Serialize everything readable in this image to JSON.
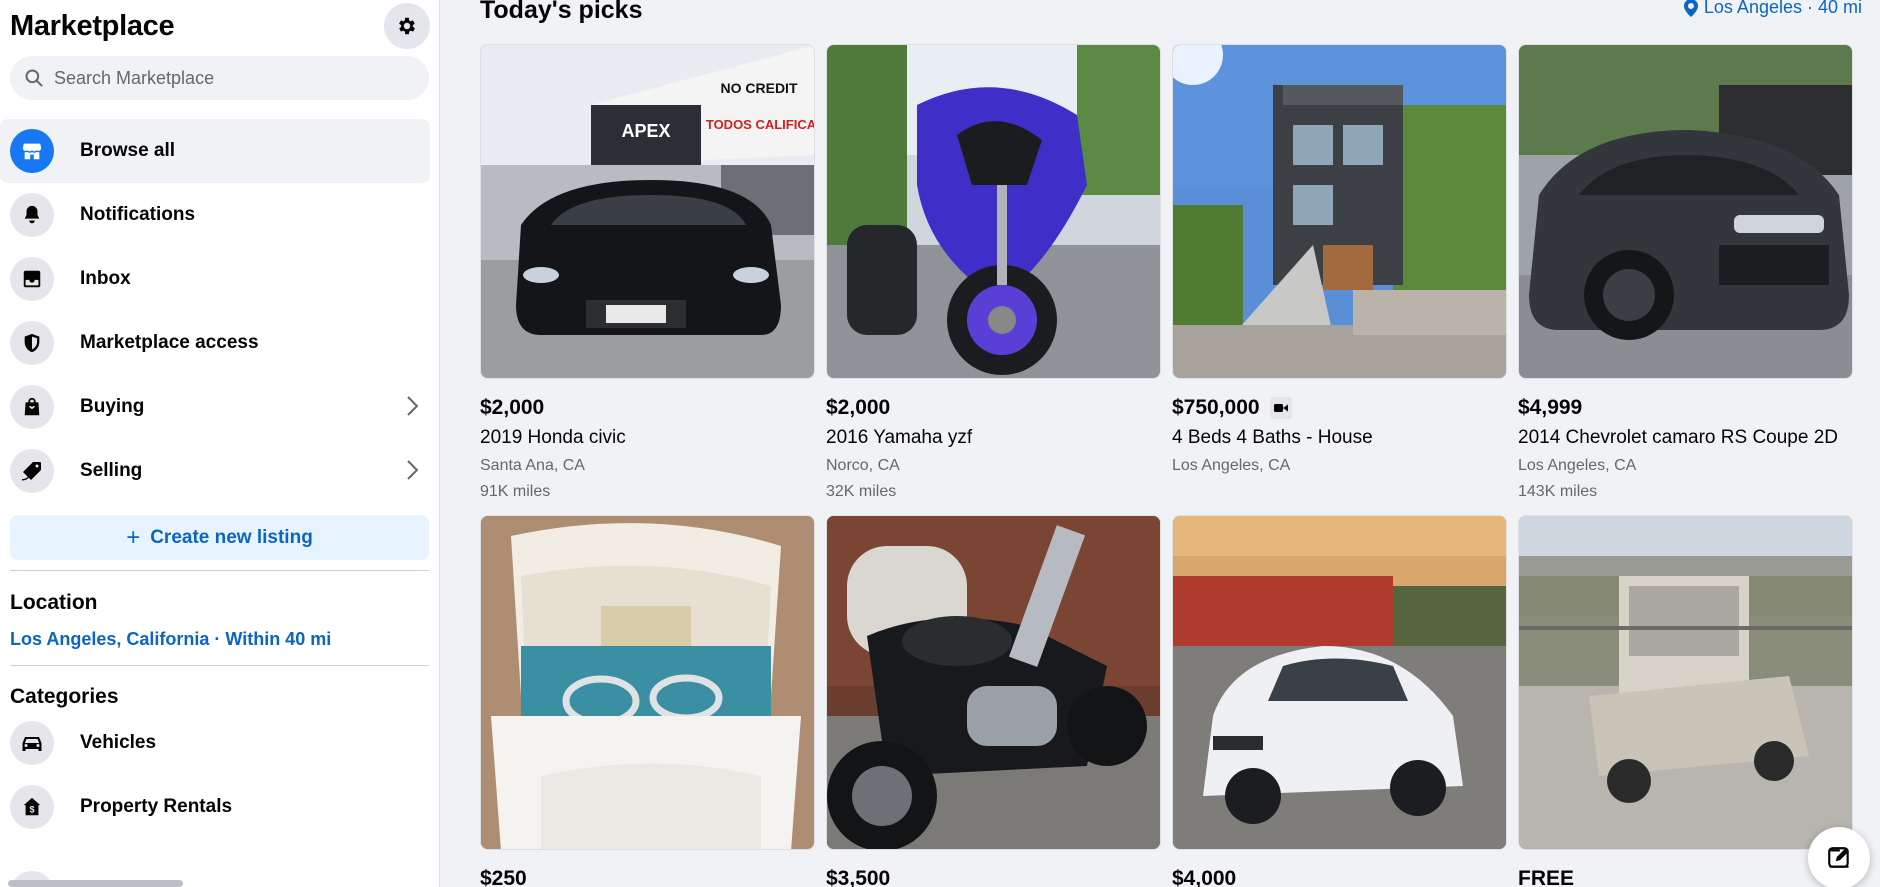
{
  "sidebar": {
    "title": "Marketplace",
    "search_placeholder": "Search Marketplace",
    "nav": [
      {
        "label": "Browse all",
        "icon": "storefront-icon"
      },
      {
        "label": "Notifications",
        "icon": "bell-icon"
      },
      {
        "label": "Inbox",
        "icon": "inbox-icon"
      },
      {
        "label": "Marketplace access",
        "icon": "shield-icon"
      },
      {
        "label": "Buying",
        "icon": "shopping-bag-icon"
      },
      {
        "label": "Selling",
        "icon": "tag-icon"
      }
    ],
    "create_label": "Create new listing",
    "location_heading": "Location",
    "location_value": "Los Angeles, California · Within 40 mi",
    "categories_heading": "Categories",
    "categories": [
      {
        "label": "Vehicles",
        "icon": "car-icon"
      },
      {
        "label": "Property Rentals",
        "icon": "house-dollar-icon"
      }
    ]
  },
  "main": {
    "heading": "Today's picks",
    "location": "Los Angeles · 40 mi",
    "listings": [
      {
        "price": "$2,000",
        "title": "2019 Honda civic",
        "location": "Santa Ana, CA",
        "miles": "91K miles"
      },
      {
        "price": "$2,000",
        "title": "2016 Yamaha yzf",
        "location": "Norco, CA",
        "miles": "32K miles"
      },
      {
        "price": "$750,000",
        "title": "4 Beds 4 Baths - House",
        "location": "Los Angeles, CA",
        "miles": "",
        "video": true
      },
      {
        "price": "$4,999",
        "title": "2014 Chevrolet camaro RS Coupe 2D",
        "location": "Los Angeles, CA",
        "miles": "143K miles"
      },
      {
        "price": "$250"
      },
      {
        "price": "$3,500"
      },
      {
        "price": "$4,000"
      },
      {
        "price": "FREE"
      }
    ]
  },
  "colors": {
    "accent": "#0a66c2",
    "brand": "#1877f2",
    "background": "#f0f2f5"
  }
}
